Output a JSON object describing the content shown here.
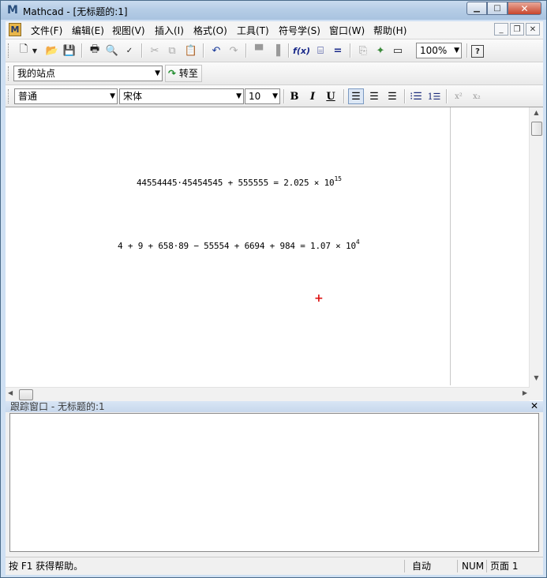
{
  "window": {
    "title": "Mathcad - [无标题的:1]",
    "app_icon": "M"
  },
  "menu": {
    "items": [
      "文件(F)",
      "编辑(E)",
      "视图(V)",
      "插入(I)",
      "格式(O)",
      "工具(T)",
      "符号学(S)",
      "窗口(W)",
      "帮助(H)"
    ]
  },
  "toolbar": {
    "zoom": "100%"
  },
  "nav": {
    "site": "我的站点",
    "goto_label": "转至"
  },
  "format": {
    "style": "普通",
    "font": "宋体",
    "size": "10",
    "bold": "B",
    "italic": "I",
    "underline": "U",
    "superscript": "x²",
    "subscript": "x₂"
  },
  "worksheet": {
    "eq1_lhs": "44554445·45454545 + 555555 = 2.025 × 10",
    "eq1_exp": "15",
    "eq2_lhs": "4 + 9 + 658·89 − 55554 + 6694 + 984 = 1.07 × 10",
    "eq2_exp": "4"
  },
  "trace": {
    "title": "跟踪窗口 - 无标题的:1"
  },
  "status": {
    "help": "按 F1 获得帮助。",
    "mode": "自动",
    "num": "NUM",
    "page": "页面 1"
  }
}
